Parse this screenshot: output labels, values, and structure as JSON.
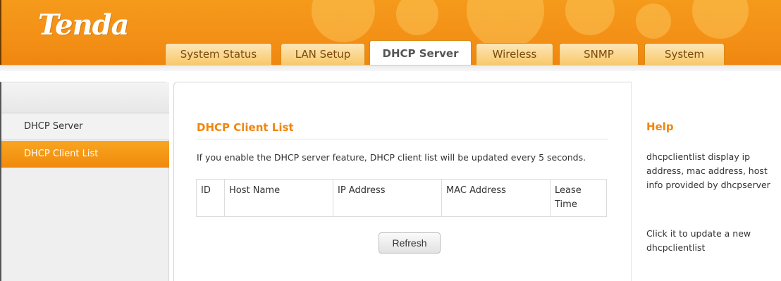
{
  "brand": {
    "logo_text": "Tenda",
    "accent_color": "#f0860f"
  },
  "tabs": [
    {
      "label": "System Status",
      "active": false
    },
    {
      "label": "LAN Setup",
      "active": false
    },
    {
      "label": "DHCP Server",
      "active": true
    },
    {
      "label": "Wireless",
      "active": false
    },
    {
      "label": "SNMP",
      "active": false
    },
    {
      "label": "System",
      "active": false
    }
  ],
  "sidebar": {
    "items": [
      {
        "label": "DHCP Server",
        "active": false
      },
      {
        "label": "DHCP Client List",
        "active": true
      }
    ]
  },
  "main": {
    "title": "DHCP Client List",
    "info": "If you enable the DHCP server feature, DHCP client list will be updated every 5 seconds.",
    "table": {
      "headers": [
        "ID",
        "Host Name",
        "IP Address",
        "MAC Address",
        "Lease Time"
      ],
      "rows": []
    },
    "refresh_label": "Refresh"
  },
  "help": {
    "title": "Help",
    "paragraph1": "dhcpclientlist display ip address‚ mac address‚ host info provided by dhcpserver",
    "paragraph2": "Click it to update a new dhcpclientlist"
  }
}
